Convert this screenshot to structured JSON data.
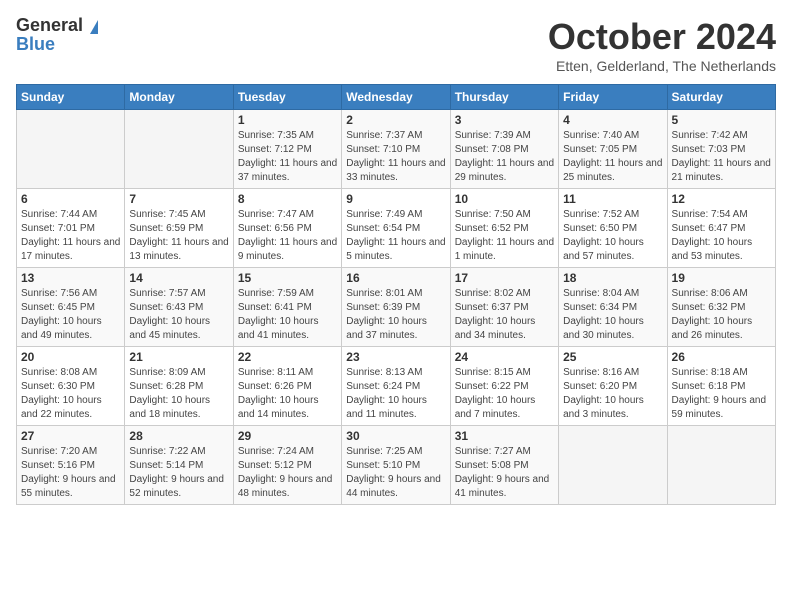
{
  "logo": {
    "general": "General",
    "blue": "Blue"
  },
  "title": "October 2024",
  "location": "Etten, Gelderland, The Netherlands",
  "weekdays": [
    "Sunday",
    "Monday",
    "Tuesday",
    "Wednesday",
    "Thursday",
    "Friday",
    "Saturday"
  ],
  "weeks": [
    [
      {
        "day": "",
        "info": ""
      },
      {
        "day": "",
        "info": ""
      },
      {
        "day": "1",
        "info": "Sunrise: 7:35 AM\nSunset: 7:12 PM\nDaylight: 11 hours and 37 minutes."
      },
      {
        "day": "2",
        "info": "Sunrise: 7:37 AM\nSunset: 7:10 PM\nDaylight: 11 hours and 33 minutes."
      },
      {
        "day": "3",
        "info": "Sunrise: 7:39 AM\nSunset: 7:08 PM\nDaylight: 11 hours and 29 minutes."
      },
      {
        "day": "4",
        "info": "Sunrise: 7:40 AM\nSunset: 7:05 PM\nDaylight: 11 hours and 25 minutes."
      },
      {
        "day": "5",
        "info": "Sunrise: 7:42 AM\nSunset: 7:03 PM\nDaylight: 11 hours and 21 minutes."
      }
    ],
    [
      {
        "day": "6",
        "info": "Sunrise: 7:44 AM\nSunset: 7:01 PM\nDaylight: 11 hours and 17 minutes."
      },
      {
        "day": "7",
        "info": "Sunrise: 7:45 AM\nSunset: 6:59 PM\nDaylight: 11 hours and 13 minutes."
      },
      {
        "day": "8",
        "info": "Sunrise: 7:47 AM\nSunset: 6:56 PM\nDaylight: 11 hours and 9 minutes."
      },
      {
        "day": "9",
        "info": "Sunrise: 7:49 AM\nSunset: 6:54 PM\nDaylight: 11 hours and 5 minutes."
      },
      {
        "day": "10",
        "info": "Sunrise: 7:50 AM\nSunset: 6:52 PM\nDaylight: 11 hours and 1 minute."
      },
      {
        "day": "11",
        "info": "Sunrise: 7:52 AM\nSunset: 6:50 PM\nDaylight: 10 hours and 57 minutes."
      },
      {
        "day": "12",
        "info": "Sunrise: 7:54 AM\nSunset: 6:47 PM\nDaylight: 10 hours and 53 minutes."
      }
    ],
    [
      {
        "day": "13",
        "info": "Sunrise: 7:56 AM\nSunset: 6:45 PM\nDaylight: 10 hours and 49 minutes."
      },
      {
        "day": "14",
        "info": "Sunrise: 7:57 AM\nSunset: 6:43 PM\nDaylight: 10 hours and 45 minutes."
      },
      {
        "day": "15",
        "info": "Sunrise: 7:59 AM\nSunset: 6:41 PM\nDaylight: 10 hours and 41 minutes."
      },
      {
        "day": "16",
        "info": "Sunrise: 8:01 AM\nSunset: 6:39 PM\nDaylight: 10 hours and 37 minutes."
      },
      {
        "day": "17",
        "info": "Sunrise: 8:02 AM\nSunset: 6:37 PM\nDaylight: 10 hours and 34 minutes."
      },
      {
        "day": "18",
        "info": "Sunrise: 8:04 AM\nSunset: 6:34 PM\nDaylight: 10 hours and 30 minutes."
      },
      {
        "day": "19",
        "info": "Sunrise: 8:06 AM\nSunset: 6:32 PM\nDaylight: 10 hours and 26 minutes."
      }
    ],
    [
      {
        "day": "20",
        "info": "Sunrise: 8:08 AM\nSunset: 6:30 PM\nDaylight: 10 hours and 22 minutes."
      },
      {
        "day": "21",
        "info": "Sunrise: 8:09 AM\nSunset: 6:28 PM\nDaylight: 10 hours and 18 minutes."
      },
      {
        "day": "22",
        "info": "Sunrise: 8:11 AM\nSunset: 6:26 PM\nDaylight: 10 hours and 14 minutes."
      },
      {
        "day": "23",
        "info": "Sunrise: 8:13 AM\nSunset: 6:24 PM\nDaylight: 10 hours and 11 minutes."
      },
      {
        "day": "24",
        "info": "Sunrise: 8:15 AM\nSunset: 6:22 PM\nDaylight: 10 hours and 7 minutes."
      },
      {
        "day": "25",
        "info": "Sunrise: 8:16 AM\nSunset: 6:20 PM\nDaylight: 10 hours and 3 minutes."
      },
      {
        "day": "26",
        "info": "Sunrise: 8:18 AM\nSunset: 6:18 PM\nDaylight: 9 hours and 59 minutes."
      }
    ],
    [
      {
        "day": "27",
        "info": "Sunrise: 7:20 AM\nSunset: 5:16 PM\nDaylight: 9 hours and 55 minutes."
      },
      {
        "day": "28",
        "info": "Sunrise: 7:22 AM\nSunset: 5:14 PM\nDaylight: 9 hours and 52 minutes."
      },
      {
        "day": "29",
        "info": "Sunrise: 7:24 AM\nSunset: 5:12 PM\nDaylight: 9 hours and 48 minutes."
      },
      {
        "day": "30",
        "info": "Sunrise: 7:25 AM\nSunset: 5:10 PM\nDaylight: 9 hours and 44 minutes."
      },
      {
        "day": "31",
        "info": "Sunrise: 7:27 AM\nSunset: 5:08 PM\nDaylight: 9 hours and 41 minutes."
      },
      {
        "day": "",
        "info": ""
      },
      {
        "day": "",
        "info": ""
      }
    ]
  ]
}
